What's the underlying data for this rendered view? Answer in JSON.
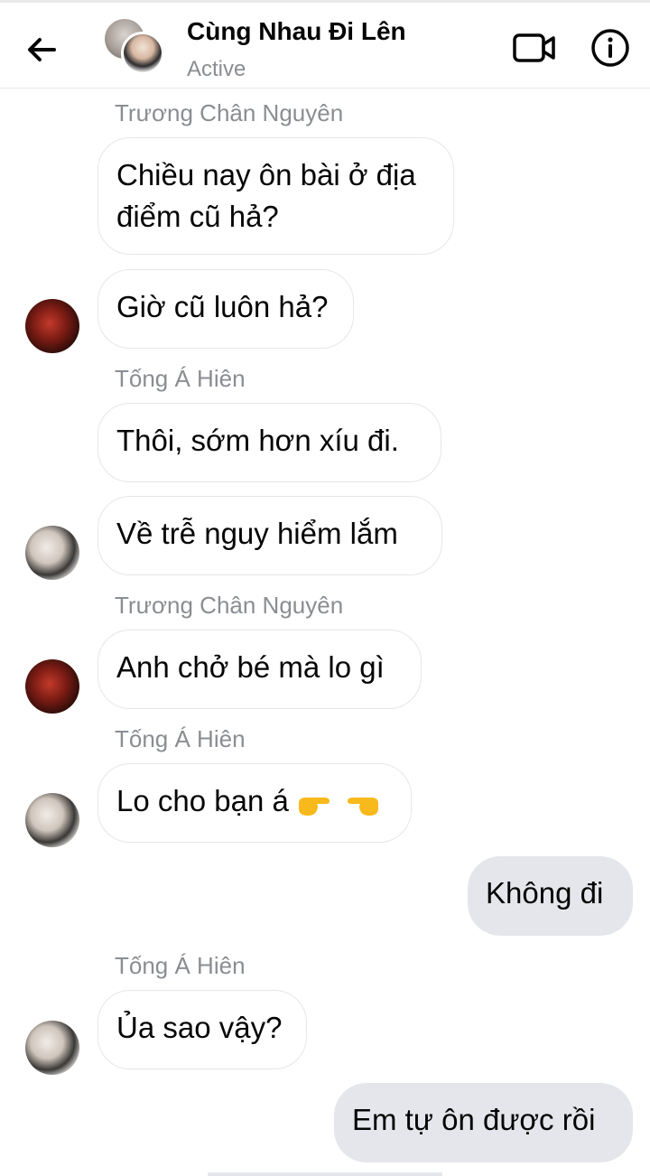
{
  "header": {
    "title": "Cùng Nhau Đi Lên",
    "status": "Active"
  },
  "messages": [
    {
      "sender": "Trương Chân Nguyên",
      "text": "Chiều nay ôn bài ở địa điểm cũ hả?"
    },
    {
      "text": "Giờ cũ luôn hả?"
    },
    {
      "sender": "Tống Á Hiên",
      "text": "Thôi, sớm hơn xíu đi."
    },
    {
      "text": "Về trễ nguy hiểm lắm"
    },
    {
      "sender": "Trương Chân Nguyên",
      "text": "Anh chở bé mà lo gì"
    },
    {
      "sender": "Tống Á Hiên",
      "text": "Lo cho bạn á "
    },
    {
      "text": "Không đi"
    },
    {
      "sender": "Tống Á Hiên",
      "text": "Ủa sao vậy?"
    },
    {
      "text": "Em tự ôn được rồi"
    }
  ],
  "icons": {
    "back": "arrow-left-icon",
    "video": "video-camera-icon",
    "info": "info-icon",
    "hands": "pointing-hands-emoji"
  },
  "colors": {
    "outgoing_bubble": "#e4e6eb",
    "incoming_border": "#e6e6e6",
    "meta_text": "#8a8d91",
    "emoji": "#f7b91b"
  }
}
